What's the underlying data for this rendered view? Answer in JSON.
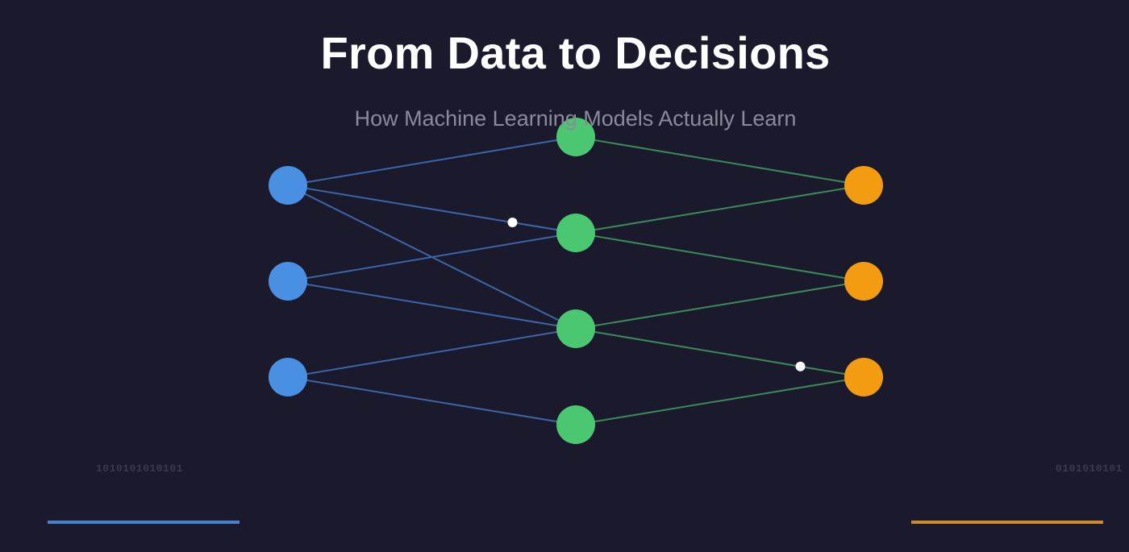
{
  "title": "From Data to Decisions",
  "subtitle": "How Machine Learning Models Actually Learn",
  "binary_left": "1010101010101",
  "binary_right": "0101010101",
  "colors": {
    "background": "#1b1a2c",
    "input_node": "#4a90e2",
    "hidden_node": "#4cc771",
    "output_node": "#f39c12",
    "input_edge": "#3c66a6",
    "hidden_edge": "#3c8a5a",
    "signal_dot": "#ffffff",
    "accent_left": "#4a82cc",
    "accent_right": "#cc8a2a"
  },
  "network": {
    "layers": [
      {
        "name": "input",
        "node_count": 3,
        "color": "input_node"
      },
      {
        "name": "hidden",
        "node_count": 4,
        "color": "hidden_node"
      },
      {
        "name": "output",
        "node_count": 3,
        "color": "output_node"
      }
    ],
    "connections_input_hidden": [
      [
        0,
        0
      ],
      [
        0,
        1
      ],
      [
        0,
        2
      ],
      [
        1,
        1
      ],
      [
        1,
        2
      ],
      [
        2,
        2
      ],
      [
        2,
        3
      ]
    ],
    "connections_hidden_output": [
      [
        0,
        0
      ],
      [
        1,
        0
      ],
      [
        1,
        1
      ],
      [
        2,
        1
      ],
      [
        2,
        2
      ],
      [
        3,
        2
      ]
    ],
    "signals": [
      {
        "stage": "input_hidden",
        "edge": [
          0,
          1
        ],
        "progress": 0.78
      },
      {
        "stage": "hidden_output",
        "edge": [
          2,
          2
        ],
        "progress": 0.78
      }
    ]
  }
}
